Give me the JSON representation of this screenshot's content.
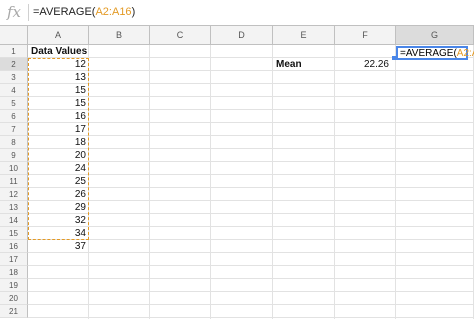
{
  "formula_bar": {
    "fx_label": "fx",
    "formula_prefix": "=AVERAGE(",
    "formula_ref": "A2:A16",
    "formula_suffix": ")"
  },
  "columns": [
    "A",
    "B",
    "C",
    "D",
    "E",
    "F",
    "G"
  ],
  "rows": [
    "1",
    "2",
    "3",
    "4",
    "5",
    "6",
    "7",
    "8",
    "9",
    "10",
    "11",
    "12",
    "13",
    "14",
    "15",
    "16",
    "17",
    "18",
    "19",
    "20",
    "21"
  ],
  "cells": {
    "a1": "Data Values",
    "data_values": [
      "12",
      "13",
      "15",
      "15",
      "16",
      "17",
      "18",
      "20",
      "24",
      "25",
      "26",
      "29",
      "32",
      "34",
      "37"
    ],
    "e2": "Mean",
    "f2": "22.26",
    "g2_prefix": "=AVERAGE(",
    "g2_ref": "A2:A16",
    "g2_suffix": ")"
  },
  "colors": {
    "accent_blue": "#4a86e8",
    "range_orange": "#e39a25",
    "header_gray": "#f3f3f3"
  }
}
